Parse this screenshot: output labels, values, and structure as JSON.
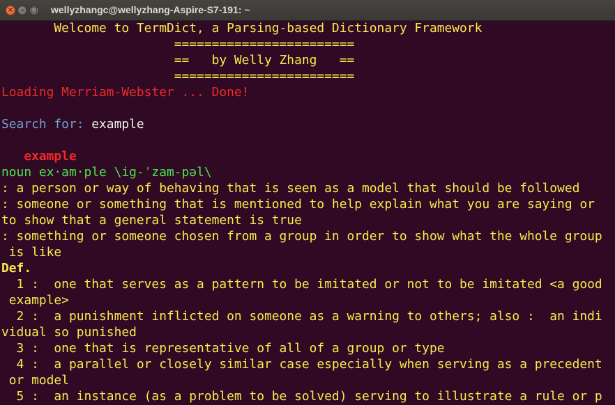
{
  "window": {
    "title": "wellyzhangc@wellyzhang-Aspire-S7-191: ~",
    "buttons": {
      "close": "×",
      "minimize": "–",
      "maximize": "□"
    }
  },
  "terminal": {
    "banner": {
      "welcome": "       Welcome to TermDict, a Parsing-based Dictionary Framework",
      "rule_top": "                       ========================",
      "byline": "                       ==   by Welly Zhang   ==",
      "rule_bottom": "                       ========================"
    },
    "loading": "Loading Merriam-Webster ... Done!",
    "search_prompt": "Search for: ",
    "search_query": "example",
    "headword": "   example",
    "pronunciation": "noun ex·am·ple \\ig-ˈzam-pəl\\",
    "senses": [
      ": a person or way of behaving that is seen as a model that should be followed",
      ": someone or something that is mentioned to help explain what you are saying or",
      "to show that a general statement is true",
      ": something or someone chosen from a group in order to show what the whole group",
      " is like"
    ],
    "def_label": "Def.",
    "definitions": [
      "  1 :  one that serves as a pattern to be imitated or not to be imitated <a good",
      " example>",
      "  2 :  a punishment inflicted on someone as a warning to others; also :  an indi",
      "vidual so punished",
      "  3 :  one that is representative of all of a group or type",
      "  4 :  a parallel or closely similar case especially when serving as a precedent",
      " or model",
      "  5 :  an instance (as a problem to be solved) serving to illustrate a rule or p"
    ]
  },
  "colors": {
    "background": "#300a24",
    "yellow": "#fce94f",
    "red": "#ef2929",
    "green": "#4ee34e",
    "blue": "#729fcf",
    "white": "#eeeeec"
  }
}
